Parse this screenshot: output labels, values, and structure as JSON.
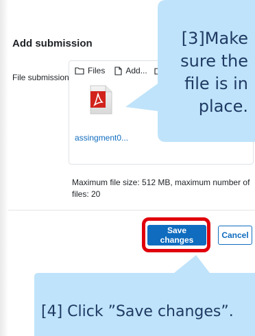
{
  "page": {
    "title": "Add submission",
    "field_label": "File submissions"
  },
  "filepicker": {
    "toolbar": {
      "files_label": "Files",
      "add_label": "Add..."
    },
    "files": [
      {
        "name": "assingment0...",
        "icon": "pdf-file-icon"
      }
    ],
    "max_size_text": "Maximum file size: 512 MB, maximum number of files: 20"
  },
  "actions": {
    "save_label": "Save changes",
    "cancel_label": "Cancel"
  },
  "annotations": {
    "step3": "[3]Make sure the file is in place.",
    "step4": "[4] Click ”Save changes”."
  },
  "colors": {
    "primary": "#0f6cbf",
    "callout_fill": "#bfe3fa",
    "callout_text": "#1f3a63",
    "highlight": "#e0000b",
    "pdf_red": "#d2221c"
  }
}
